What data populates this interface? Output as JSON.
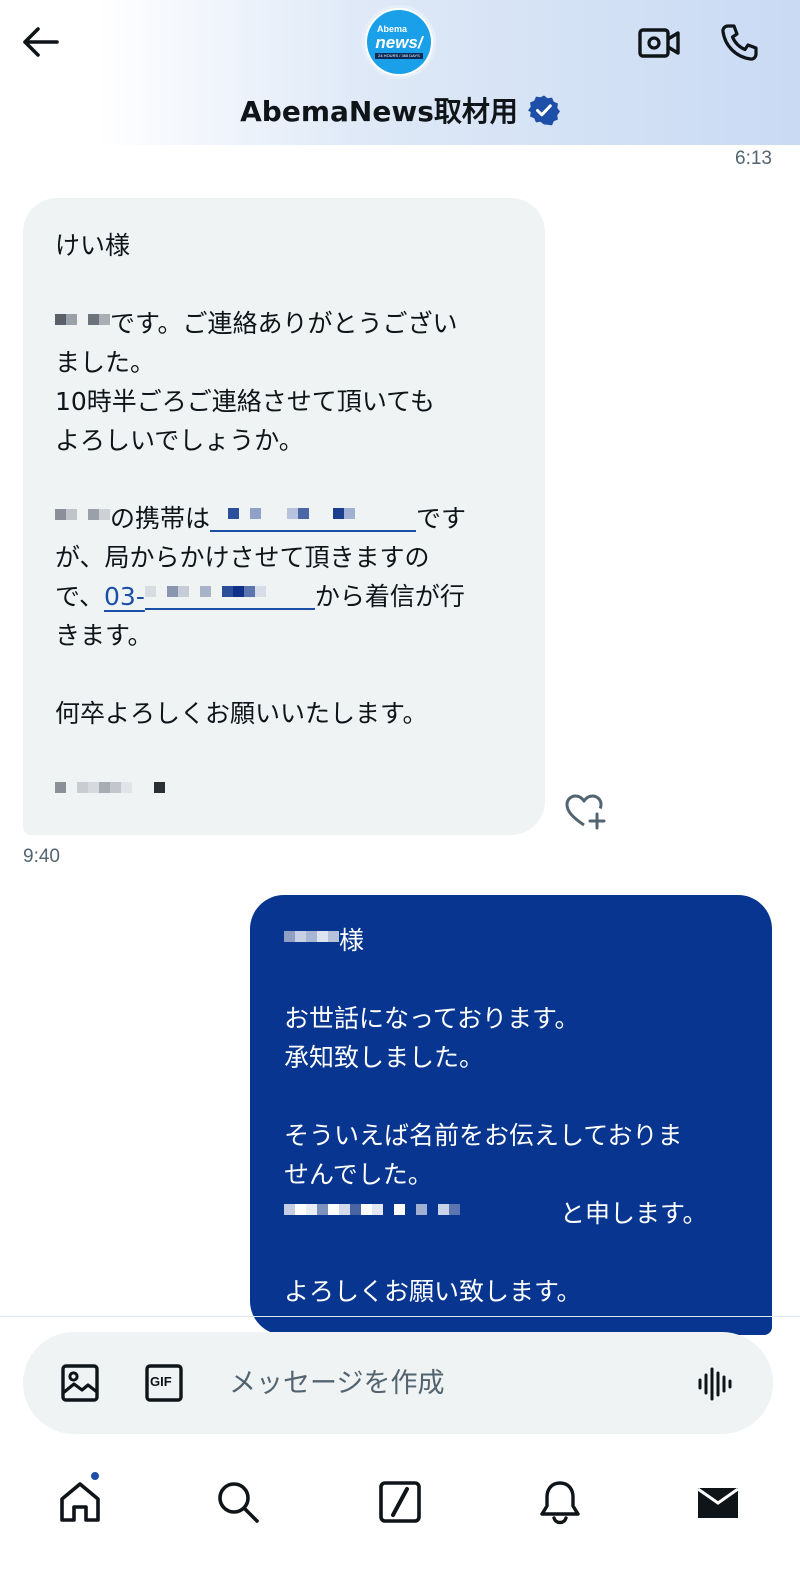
{
  "header": {
    "title": "AbemaNews取材用",
    "avatar_logo": {
      "line1": "Abema",
      "line2": "news/",
      "line3": "24 HOURS / 365 DAYS"
    },
    "icons": {
      "back": "arrow-left-icon",
      "verified": "verified-badge-icon",
      "video": "video-call-icon",
      "call": "phone-icon"
    }
  },
  "conversation": {
    "top_timestamp": "6:13",
    "incoming": {
      "lines": {
        "l1": "けい様",
        "l2": "です。ご連絡ありがとうござい",
        "l3": "ました。",
        "l4": "10時半ごろご連絡させて頂いても",
        "l5": "よろしいでしょうか。",
        "l6a": "の携帯は",
        "l6b": "です",
        "l7": "が、局からかけさせて頂きますの",
        "l8a": "で、",
        "l8link": "03-",
        "l8b": "から着信が行",
        "l9": "きます。",
        "l10": "何卒よろしくお願いいたします。"
      },
      "timestamp": "9:40"
    },
    "outgoing": {
      "lines": {
        "l1": "様",
        "l2": "お世話になっております。",
        "l3": "承知致しました。",
        "l4": "そういえば名前をお伝えしておりま",
        "l5": "せんでした。",
        "l6": "と申します。",
        "l7": "よろしくお願い致します。"
      }
    }
  },
  "composer": {
    "placeholder": "メッセージを作成",
    "icons": {
      "image": "image-icon",
      "gif": "gif-icon",
      "voice": "voice-waveform-icon"
    },
    "gif_label": "GIF"
  },
  "nav": {
    "items": [
      "home-icon",
      "search-icon",
      "compose-icon",
      "notifications-icon",
      "messages-icon"
    ]
  },
  "colors": {
    "accent": "#073590",
    "incoming_bubble": "#eff3f4",
    "link": "#1a4fa8",
    "verified": "#1d4ea8"
  }
}
